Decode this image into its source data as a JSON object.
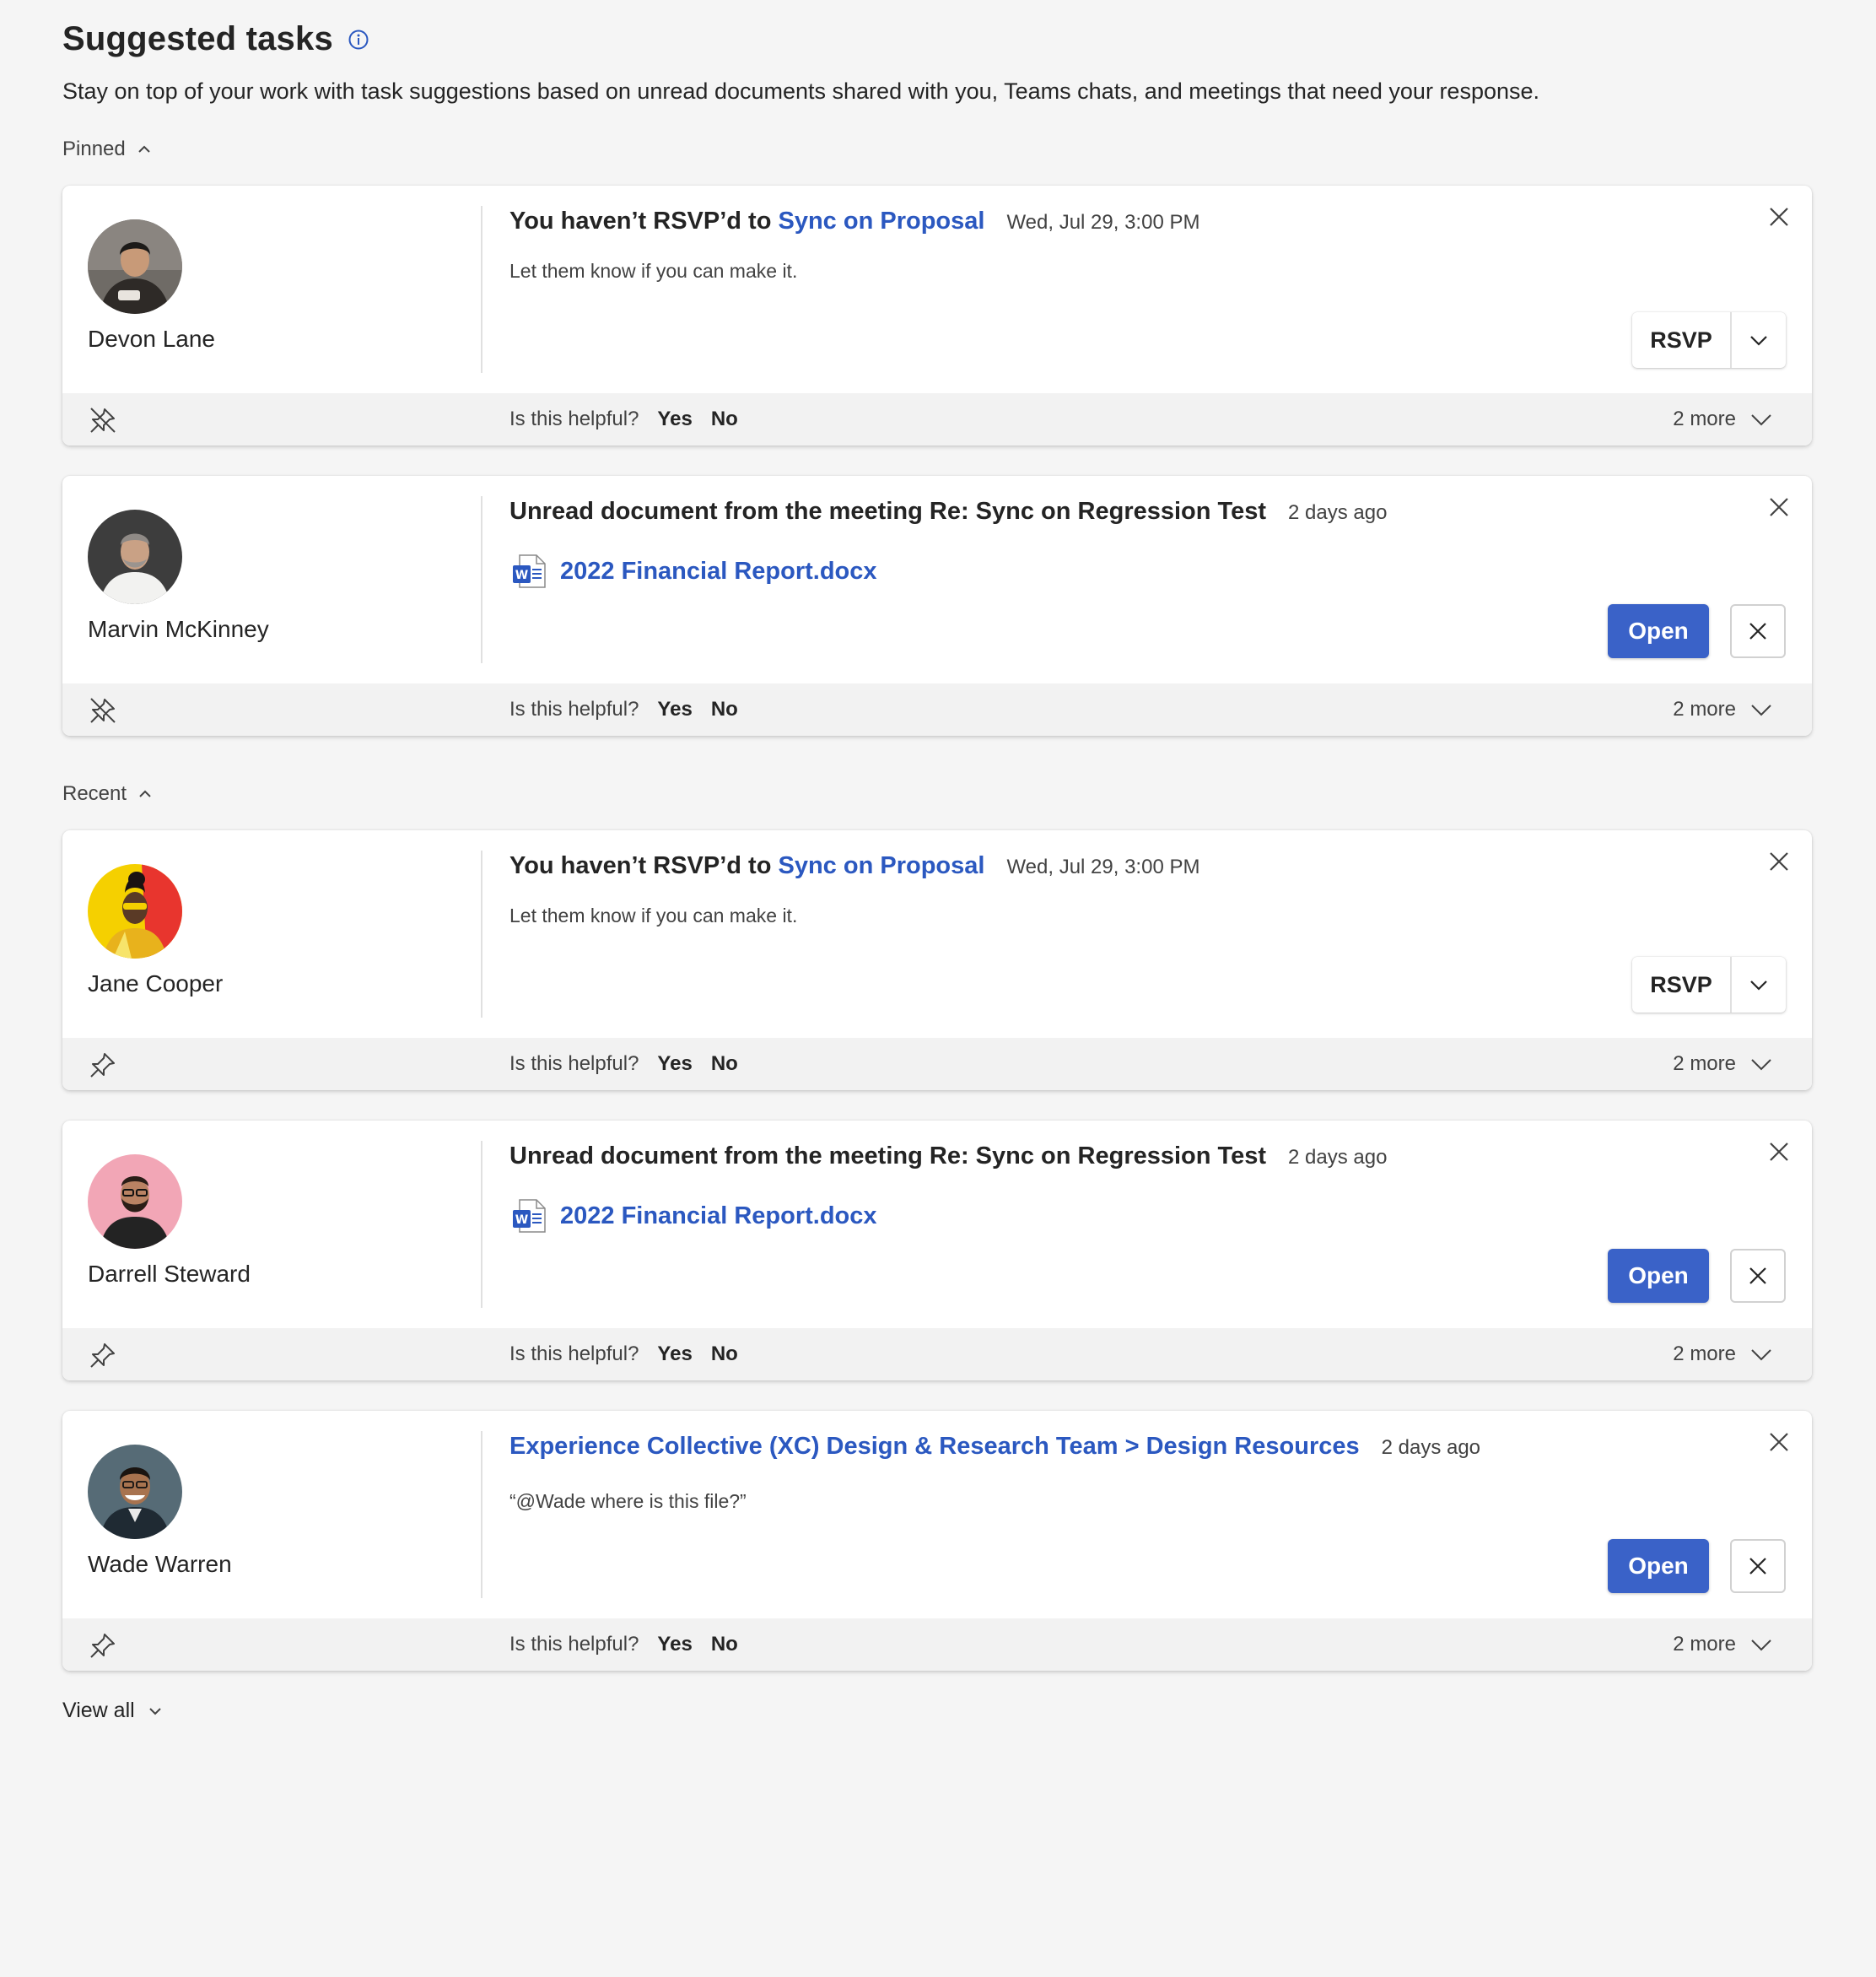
{
  "header": {
    "title": "Suggested tasks",
    "subtitle": "Stay on top of your work with task suggestions based on unread documents shared with you, Teams chats, and meetings that need your response."
  },
  "sections": {
    "pinned": "Pinned",
    "recent": "Recent"
  },
  "footer_labels": {
    "helpful_question": "Is this helpful?",
    "yes": "Yes",
    "no": "No",
    "more": "2 more"
  },
  "buttons": {
    "rsvp": "RSVP",
    "open": "Open"
  },
  "cards": [
    {
      "name": "Devon Lane",
      "headline_prefix": "You haven’t RSVP’d to ",
      "headline_link": "Sync on Proposal",
      "timestamp": "Wed, Jul 29, 3:00 PM",
      "description": "Let them know if you can make it."
    },
    {
      "name": "Marvin McKinney",
      "headline": "Unread document from the meeting Re: Sync on Regression Test",
      "timestamp": "2 days ago",
      "document": "2022 Financial Report.docx"
    },
    {
      "name": "Jane Cooper",
      "headline_prefix": "You haven’t RSVP’d to ",
      "headline_link": "Sync on Proposal",
      "timestamp": "Wed, Jul 29, 3:00 PM",
      "description": "Let them know if you can make it."
    },
    {
      "name": "Darrell Steward",
      "headline": "Unread document from the meeting Re: Sync on Regression Test",
      "timestamp": "2 days ago",
      "document": "2022 Financial Report.docx"
    },
    {
      "name": "Wade Warren",
      "channel_link": "Experience Collective (XC) Design & Research Team > Design Resources",
      "timestamp": "2 days ago",
      "description": "“@Wade where is this file?”"
    }
  ],
  "view_all": "View all",
  "colors": {
    "link": "#2b58c0",
    "primary_button": "#3a62c8",
    "background": "#f5f5f5"
  }
}
